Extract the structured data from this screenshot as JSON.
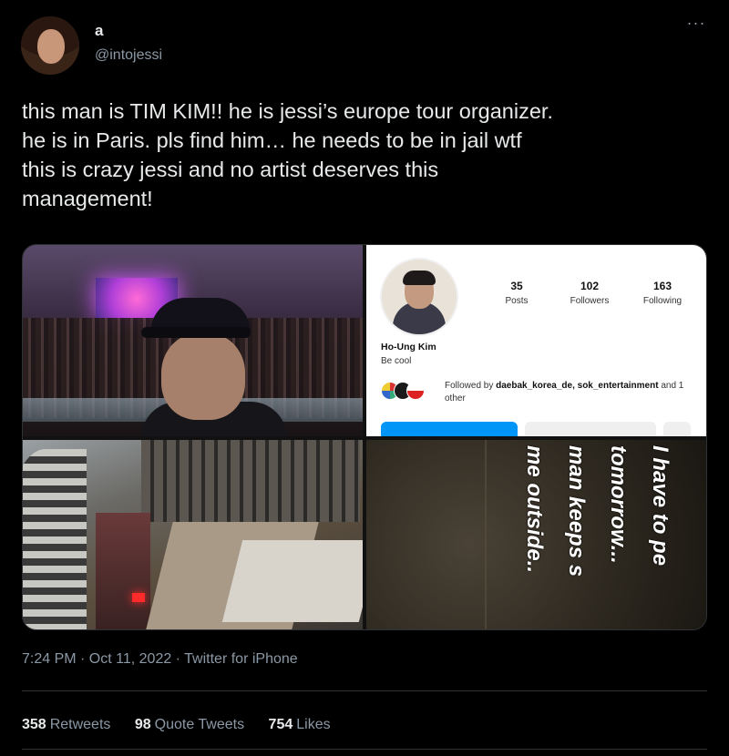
{
  "tweet": {
    "display_name": "a",
    "handle": "@intojessi",
    "text": "this man is TIM KIM!! he is jessi’s europe tour organizer.\nhe is in Paris. pls find him… he needs to be in jail wtf\nthis is crazy jessi and no artist deserves this\nmanagement!",
    "more_label": "···",
    "timestamp": "7:24 PM · Oct 11, 2022 · Twitter for iPhone"
  },
  "media": {
    "instagram": {
      "posts_count": "35",
      "posts_label": "Posts",
      "followers_count": "102",
      "followers_label": "Followers",
      "following_count": "163",
      "following_label": "Following",
      "name": "Ho-Ung Kim",
      "bio": "Be cool",
      "followed_by_prefix": "Followed by ",
      "followed_by_accounts": "daebak_korea_de, sok_entertainment",
      "followed_by_suffix": " and 1 other"
    },
    "story_text": "I have to pe\ntomorrow...\nman keeps s\nme outside.."
  },
  "stats": {
    "retweets_count": "358",
    "retweets_label": "Retweets",
    "quote_count": "98",
    "quote_label": "Quote Tweets",
    "likes_count": "754",
    "likes_label": "Likes"
  },
  "colors": {
    "background": "#000000",
    "text": "#e7e9ea",
    "secondary_text": "#8b98a5",
    "divider": "#2f3336",
    "follow_button": "#0095f6"
  }
}
